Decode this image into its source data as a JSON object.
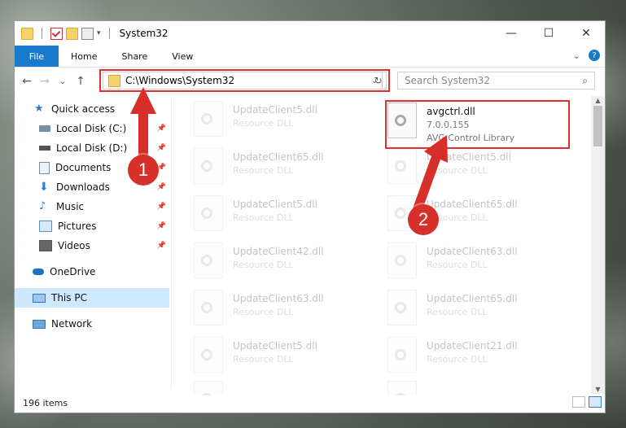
{
  "window": {
    "title": "System32",
    "controls": {
      "minimize": "—",
      "maximize": "☐",
      "close": "✕"
    }
  },
  "ribbon": {
    "tabs": [
      {
        "label": "File"
      },
      {
        "label": "Home"
      },
      {
        "label": "Share"
      },
      {
        "label": "View"
      }
    ],
    "expand": "⌄",
    "help": "?"
  },
  "nav": {
    "back": "←",
    "forward": "→",
    "recent": "⌄",
    "up": "↑",
    "address": "C:\\Windows\\System32",
    "address_chevron": "⌄",
    "refresh": "↻",
    "search_placeholder": "Search System32",
    "search_icon": "search-icon"
  },
  "sidebar": {
    "items": [
      {
        "label": "Quick access",
        "icon": "star-icon"
      },
      {
        "label": "Local Disk (C:)",
        "icon": "drive-icon"
      },
      {
        "label": "Local Disk (D:)",
        "icon": "drive-icon"
      },
      {
        "label": "Documents",
        "icon": "documents-icon"
      },
      {
        "label": "Downloads",
        "icon": "download-icon"
      },
      {
        "label": "Music",
        "icon": "music-icon"
      },
      {
        "label": "Pictures",
        "icon": "pictures-icon"
      },
      {
        "label": "Videos",
        "icon": "videos-icon"
      },
      {
        "label": "OneDrive",
        "icon": "cloud-icon"
      },
      {
        "label": "This PC",
        "icon": "computer-icon"
      },
      {
        "label": "Network",
        "icon": "network-icon"
      }
    ]
  },
  "files": {
    "highlighted": {
      "name": "avgctrl.dll",
      "version": "7.0.0.155",
      "description": "AVG Control Library"
    },
    "left": [
      {
        "name": "UpdateClient5.dll",
        "type": "Resource DLL"
      },
      {
        "name": "UpdateClient65.dll",
        "type": "Resource DLL"
      },
      {
        "name": "UpdateClient5.dll",
        "type": "Resource DLL"
      },
      {
        "name": "UpdateClient42.dll",
        "type": "Resource DLL"
      },
      {
        "name": "UpdateClient63.dll",
        "type": "Resource DLL"
      },
      {
        "name": "UpdateClient5.dll",
        "type": "Resource DLL"
      },
      {
        "name": "",
        "type": ""
      }
    ],
    "right": [
      {
        "name": "UpdateClient5.dll",
        "type": "Resource DLL"
      },
      {
        "name": "UpdateClient65.dll",
        "type": "Resource DLL"
      },
      {
        "name": "UpdateClient63.dll",
        "type": "Resource DLL"
      },
      {
        "name": "UpdateClient65.dll",
        "type": "Resource DLL"
      },
      {
        "name": "UpdateClient21.dll",
        "type": "Resource DLL"
      },
      {
        "name": "",
        "type": ""
      }
    ]
  },
  "status": {
    "count": "196 items"
  },
  "annotations": {
    "step1": "1",
    "step2": "2",
    "color": "#d7302a"
  }
}
